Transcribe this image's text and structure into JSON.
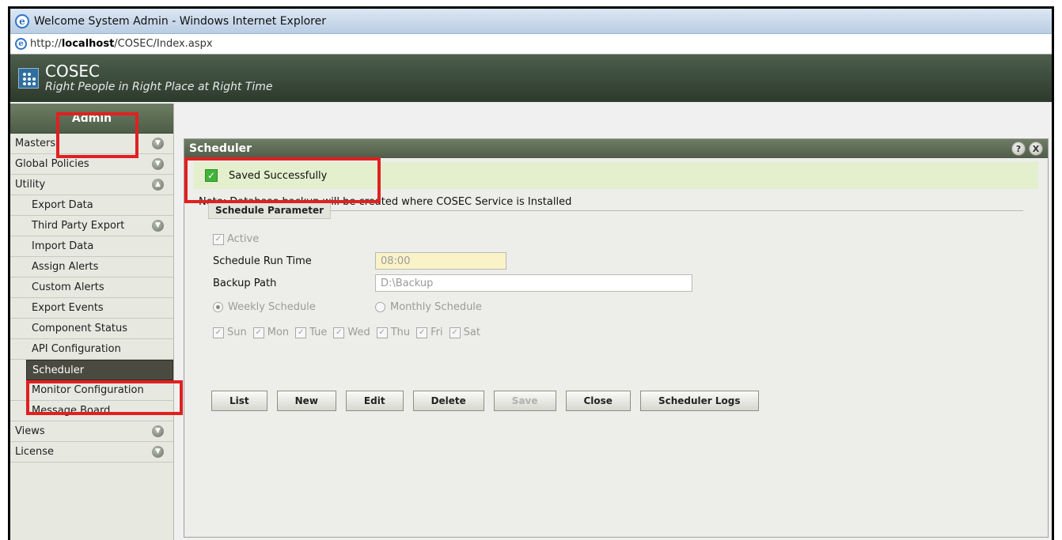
{
  "window": {
    "title": "Welcome System Admin - Windows Internet Explorer",
    "url_prefix": "http://",
    "url_host": "localhost",
    "url_path": "/COSEC/Index.aspx"
  },
  "app": {
    "name": "COSEC",
    "tagline": "Right People in Right Place at Right Time"
  },
  "sidebar": {
    "header": "Admin",
    "items": [
      {
        "label": "Masters",
        "expandable": true
      },
      {
        "label": "Global Policies",
        "expandable": true
      },
      {
        "label": "Utility",
        "expandable": true,
        "expanded": true
      },
      {
        "label": "Export Data"
      },
      {
        "label": "Third Party Export",
        "expandable": true
      },
      {
        "label": "Import Data"
      },
      {
        "label": "Assign Alerts"
      },
      {
        "label": "Custom Alerts"
      },
      {
        "label": "Export Events"
      },
      {
        "label": "Component Status"
      },
      {
        "label": "API Configuration"
      },
      {
        "label": "Scheduler",
        "active": true
      },
      {
        "label": "Monitor Configuration"
      },
      {
        "label": "Message Board"
      },
      {
        "label": "Views",
        "expandable": true
      },
      {
        "label": "License",
        "expandable": true
      }
    ]
  },
  "panel": {
    "title": "Scheduler",
    "help_icon": "?",
    "close_icon": "X",
    "success_message": "Saved Successfully",
    "note": "Note: Database backup will be created where COSEC Service is Installed",
    "section_title": "Schedule Parameter",
    "active_label": "Active",
    "run_time_label": "Schedule Run Time",
    "run_time_value": "08:00",
    "backup_path_label": "Backup Path",
    "backup_path_value": "D:\\Backup",
    "weekly_label": "Weekly Schedule",
    "monthly_label": "Monthly Schedule",
    "days": [
      "Sun",
      "Mon",
      "Tue",
      "Wed",
      "Thu",
      "Fri",
      "Sat"
    ],
    "buttons": {
      "list": "List",
      "new": "New",
      "edit": "Edit",
      "delete": "Delete",
      "save": "Save",
      "close": "Close",
      "logs": "Scheduler Logs"
    }
  },
  "colors": {
    "highlight": "#e02020",
    "header_green": "#4f5c48",
    "success_bg": "#e4efcd"
  }
}
